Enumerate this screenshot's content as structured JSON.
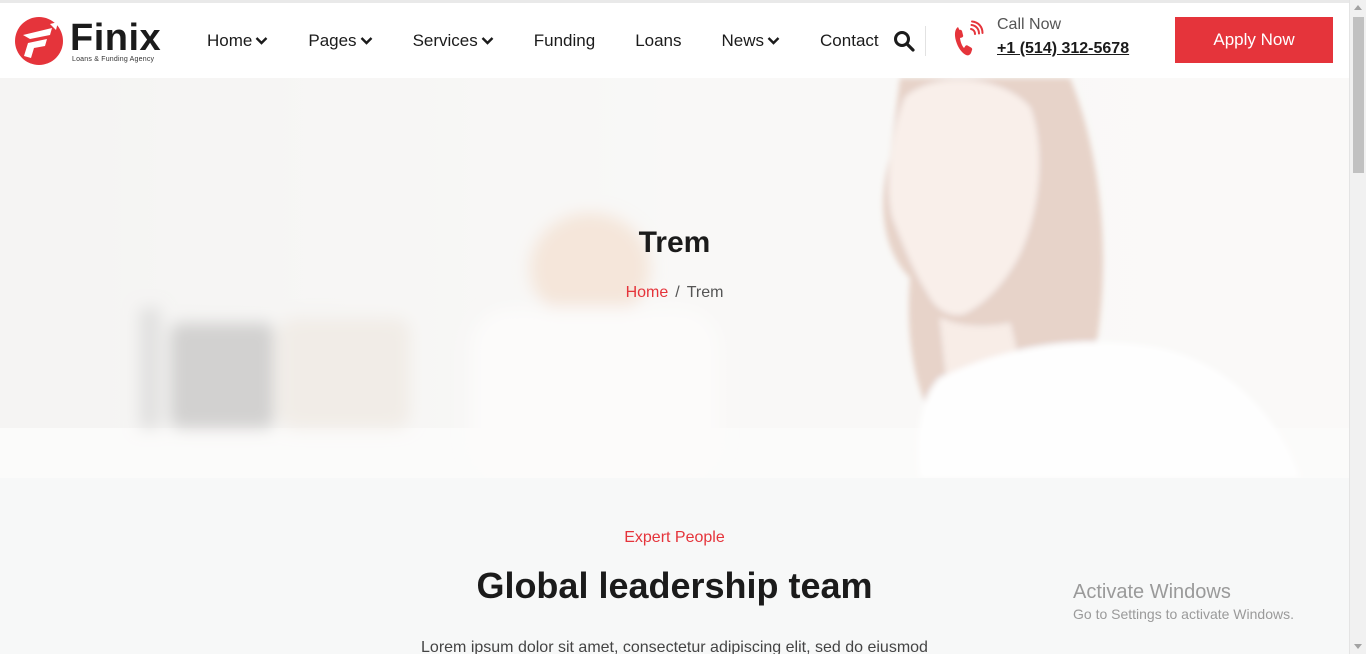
{
  "brand": {
    "name": "Finix",
    "tagline": "Loans & Funding Agency",
    "accent_color": "#e5343b"
  },
  "nav": {
    "items": [
      {
        "label": "Home",
        "has_dropdown": true
      },
      {
        "label": "Pages",
        "has_dropdown": true
      },
      {
        "label": "Services",
        "has_dropdown": true
      },
      {
        "label": "Funding",
        "has_dropdown": false
      },
      {
        "label": "Loans",
        "has_dropdown": false
      },
      {
        "label": "News",
        "has_dropdown": true
      },
      {
        "label": "Contact",
        "has_dropdown": false
      }
    ]
  },
  "header": {
    "search_icon": "search-icon",
    "call_label": "Call Now",
    "call_number": "+1 (514) 312-5678",
    "apply_label": "Apply Now"
  },
  "hero": {
    "title": "Trem",
    "breadcrumb": {
      "home": "Home",
      "separator": "/",
      "current": "Trem"
    }
  },
  "section": {
    "eyebrow": "Expert People",
    "title": "Global leadership team",
    "text": "Lorem ipsum dolor sit amet, consectetur adipiscing elit, sed do eiusmod"
  },
  "watermark": {
    "title": "Activate Windows",
    "subtitle": "Go to Settings to activate Windows."
  }
}
